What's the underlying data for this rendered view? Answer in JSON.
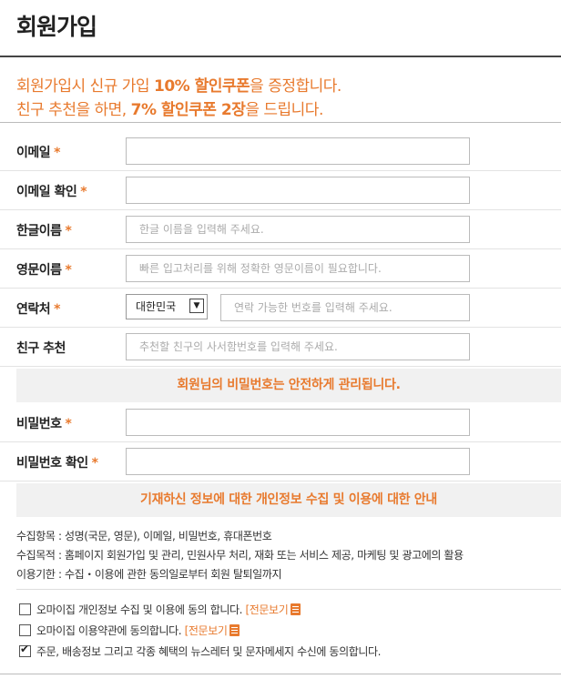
{
  "title": "회원가입",
  "promo": {
    "line1_a": "회원가입시 신규 가입 ",
    "line1_b": "10% 할인쿠폰",
    "line1_c": "을 증정합니다.",
    "line2_a": "친구 추천을 하면, ",
    "line2_b": "7% 할인쿠폰 2장",
    "line2_c": "을 드립니다."
  },
  "form": {
    "required_mark": "*",
    "email": {
      "label": "이메일",
      "value": ""
    },
    "email_confirm": {
      "label": "이메일 확인",
      "value": ""
    },
    "korean_name": {
      "label": "한글이름",
      "placeholder": "한글 이름을 입력해 주세요."
    },
    "english_name": {
      "label": "영문이름",
      "placeholder": "빠른 입고처리를 위해 정확한 영문이름이 필요합니다."
    },
    "contact": {
      "label": "연락처",
      "country": "대한민국",
      "placeholder": "연락 가능한 번호를 입력해 주세요."
    },
    "referral": {
      "label": "친구 추천",
      "placeholder": "추천할 친구의 사서함번호를 입력해 주세요."
    },
    "password_notice": "회원님의 비밀번호는 안전하게 관리됩니다.",
    "password": {
      "label": "비밀번호",
      "value": ""
    },
    "password_confirm": {
      "label": "비밀번호 확인",
      "value": ""
    },
    "privacy_notice": "기재하신 정보에 대한 개인정보 수집 및 이용에 대한 안내"
  },
  "privacy_info": {
    "items": "수집항목 : 성명(국문, 영문), 이메일, 비밀번호, 휴대폰번호",
    "purpose": "수집목적 : 홈페이지 회원가입 및 관리, 민원사무 처리, 재화 또는 서비스 제공, 마케팅 및 광고에의 활용",
    "period": "이용기한 : 수집・이용에 관한 동의일로부터 회원 탈퇴일까지"
  },
  "agreements": [
    {
      "text": "오마이집 개인정보 수집 및 이용에 동의 합니다.",
      "link": "[전문보기",
      "checked": false
    },
    {
      "text": "오마이집 이용약관에 동의합니다.",
      "link": "[전문보기",
      "checked": false
    },
    {
      "text": "주문, 배송정보 그리고 각종 혜택의 뉴스레터 및 문자메세지 수신에 동의합니다.",
      "checked": true
    }
  ],
  "icons": {
    "checkbox": "checkbox-icon",
    "document": "document-icon",
    "dropdown": "dropdown-arrow-icon"
  },
  "colors": {
    "accent": "#e87a2e"
  }
}
